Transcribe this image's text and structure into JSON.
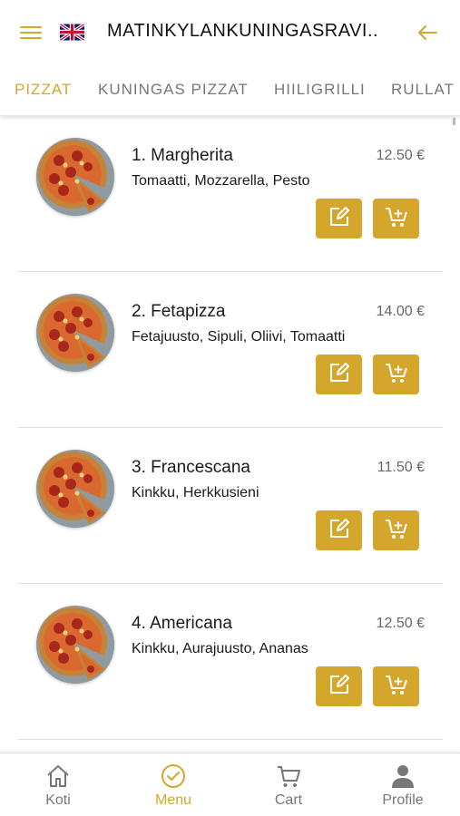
{
  "header": {
    "title": "MATINKYLANKUNINGASRAVI...",
    "menu_icon": "hamburger-icon",
    "flag_icon": "uk-flag-icon",
    "back_icon": "arrow-left-icon"
  },
  "tabs": [
    {
      "label": "PIZZAT",
      "active": true
    },
    {
      "label": "KUNINGAS PIZZAT",
      "active": false
    },
    {
      "label": "HIILIGRILLI",
      "active": false
    },
    {
      "label": "RULLAT",
      "active": false
    }
  ],
  "items": [
    {
      "name": "1. Margherita",
      "price": "12.50 €",
      "description": "Tomaatti, Mozzarella, Pesto"
    },
    {
      "name": "2. Fetapizza",
      "price": "14.00 €",
      "description": "Fetajuusto, Sipuli, Oliivi, Tomaatti"
    },
    {
      "name": "3. Francescana",
      "price": "11.50 €",
      "description": "Kinkku, Herkkusieni"
    },
    {
      "name": "4. Americana",
      "price": "12.50 €",
      "description": "Kinkku, Aurajuusto, Ananas"
    }
  ],
  "bottom_nav": [
    {
      "label": "Koti",
      "icon": "home-icon",
      "active": false
    },
    {
      "label": "Menu",
      "icon": "check-circle-icon",
      "active": true
    },
    {
      "label": "Cart",
      "icon": "cart-icon",
      "active": false
    },
    {
      "label": "Profile",
      "icon": "person-icon",
      "active": false
    }
  ],
  "colors": {
    "accent": "#d4a72c",
    "inactive": "#777777",
    "divider": "#e2e2e2"
  }
}
